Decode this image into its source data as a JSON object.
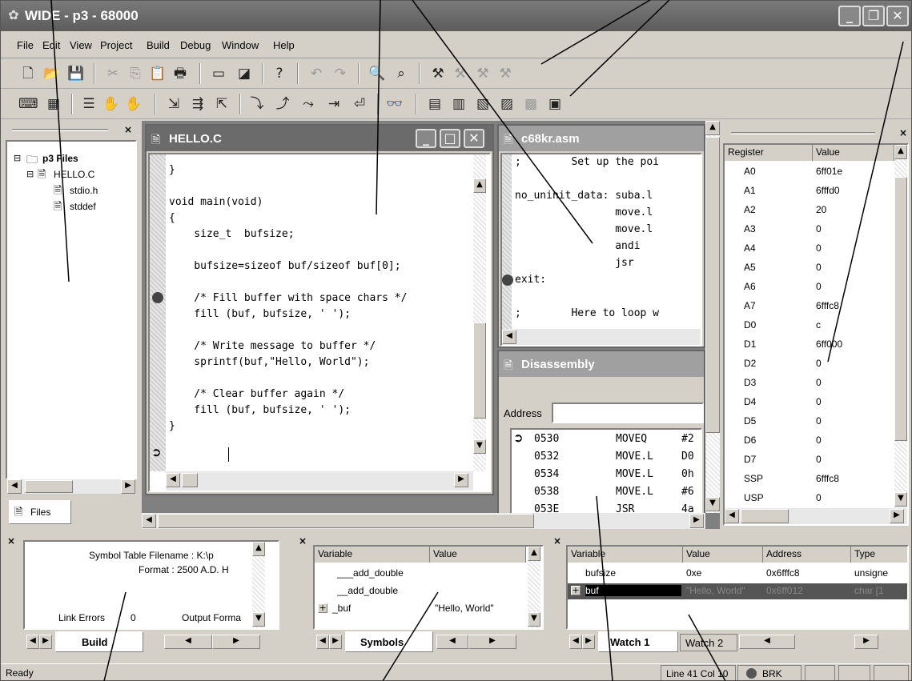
{
  "window": {
    "title": "WIDE - p3 - 68000"
  },
  "menu": [
    "File",
    "Edit",
    "View",
    "Project",
    "Build",
    "Debug",
    "Window",
    "Help"
  ],
  "project": {
    "root": "p3 Files",
    "file": "HELLO.C",
    "children": [
      "stdio.h",
      "stddef"
    ],
    "tab": "Files"
  },
  "editor": {
    "title": "HELLO.C",
    "lines": [
      "}",
      "",
      "void main(void)",
      "{",
      "    size_t  bufsize;",
      "",
      "    bufsize=sizeof buf/sizeof buf[0];",
      "",
      "    /* Fill buffer with space chars */",
      "    fill (buf, bufsize, ' ');",
      "",
      "    /* Write message to buffer */",
      "    sprintf(buf,\"Hello, World\");",
      "",
      "    /* Clear buffer again */",
      "    fill (buf, bufsize, ' ');",
      "}"
    ]
  },
  "asm": {
    "title": "c68kr.asm",
    "lines": [
      ";        Set up the poi",
      "",
      "no_uninit_data: suba.l",
      "                move.l",
      "                move.l",
      "                andi",
      "                jsr",
      "exit:",
      "",
      ";        Here to loop w"
    ]
  },
  "disasm": {
    "title": "Disassembly",
    "address_label": "Address",
    "rows": [
      {
        "addr": "0530",
        "op": "MOVEQ",
        "arg": "#2"
      },
      {
        "addr": "0532",
        "op": "MOVE.L",
        "arg": "D0"
      },
      {
        "addr": "0534",
        "op": "MOVE.L",
        "arg": "0h"
      },
      {
        "addr": "0538",
        "op": "MOVE.L",
        "arg": "#6"
      },
      {
        "addr": "053E",
        "op": "JSR",
        "arg": "4a"
      }
    ]
  },
  "registers": {
    "headers": [
      "Register",
      "Value"
    ],
    "rows": [
      [
        "A0",
        "6ff01e"
      ],
      [
        "A1",
        "6fffd0"
      ],
      [
        "A2",
        "20"
      ],
      [
        "A3",
        "0"
      ],
      [
        "A4",
        "0"
      ],
      [
        "A5",
        "0"
      ],
      [
        "A6",
        "0"
      ],
      [
        "A7",
        "6fffc8"
      ],
      [
        "D0",
        "c"
      ],
      [
        "D1",
        "6ff000"
      ],
      [
        "D2",
        "0"
      ],
      [
        "D3",
        "0"
      ],
      [
        "D4",
        "0"
      ],
      [
        "D5",
        "0"
      ],
      [
        "D6",
        "0"
      ],
      [
        "D7",
        "0"
      ],
      [
        "SSP",
        "6fffc8"
      ],
      [
        "USP",
        "0"
      ]
    ]
  },
  "build": {
    "line1": "Symbol Table  Filename : K:\\p",
    "line2": "Format   : 2500 A.D. H",
    "link_errors_label": "Link Errors",
    "link_errors": "0",
    "output": "Output Forma",
    "tab": "Build"
  },
  "symbols": {
    "headers": [
      "Variable",
      "Value"
    ],
    "rows": [
      [
        "___add_double",
        ""
      ],
      [
        "__add_double",
        ""
      ],
      [
        "_buf",
        "\"Hello, World\""
      ]
    ],
    "tab": "Symbols"
  },
  "watch": {
    "headers": [
      "Variable",
      "Value",
      "Address",
      "Type"
    ],
    "rows": [
      [
        "bufsize",
        "0xe",
        "0x6fffc8",
        "unsigne"
      ],
      [
        "buf",
        "\"Hello, World\"",
        "0x6ff012",
        "char [1"
      ]
    ],
    "tabs": [
      "Watch 1",
      "Watch 2"
    ]
  },
  "status": {
    "text": "Ready",
    "position": "Line 41 Col 10",
    "brk": "BRK"
  },
  "icons": [
    "app-icon",
    "new-file-icon",
    "open-icon",
    "save-icon",
    "cut-icon",
    "copy-icon",
    "paste-icon",
    "print-icon",
    "window-icon",
    "view-icon",
    "help-icon",
    "undo-icon",
    "redo-icon",
    "find-icon",
    "find-replace-icon",
    "compile-icon",
    "build-icon",
    "rebuild-icon",
    "stop-build-icon",
    "breakpoint-icon",
    "hand-icon",
    "step-icon",
    "step-over-icon",
    "watch-icon",
    "registers-icon",
    "disasm-icon"
  ]
}
